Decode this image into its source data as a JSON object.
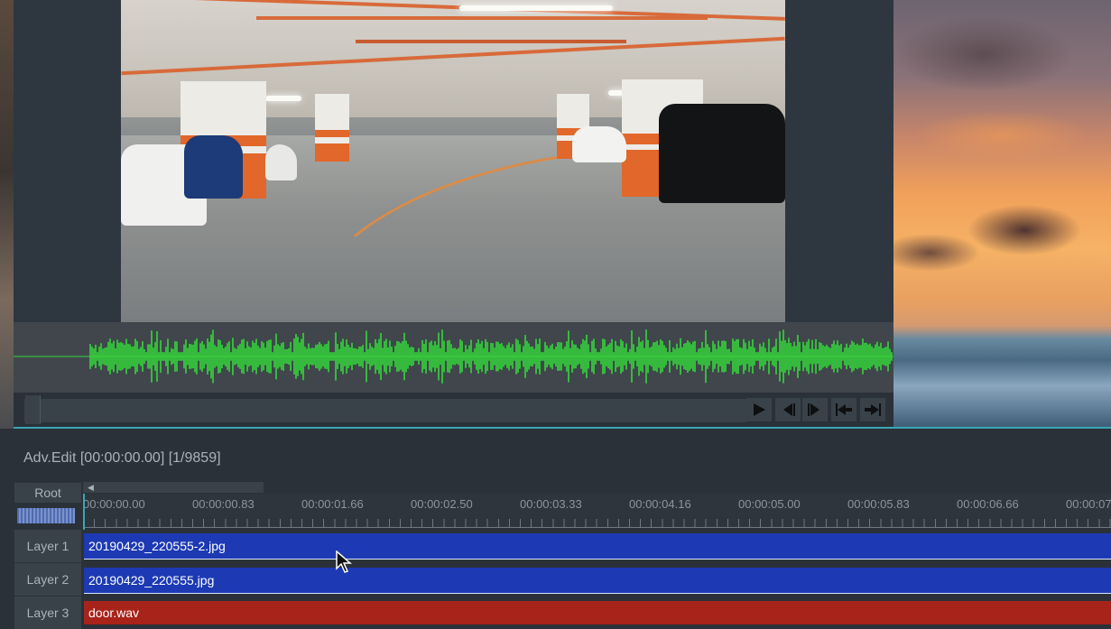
{
  "adv_edit": {
    "title": "Adv.Edit [00:00:00.00] [1/9859]",
    "root_label": "Root"
  },
  "timeline": {
    "tick_labels": [
      "00:00:00.00",
      "00:00:00.83",
      "00:00:01.66",
      "00:00:02.50",
      "00:00:03.33",
      "00:00:04.16",
      "00:00:05.00",
      "00:00:05.83",
      "00:00:06.66",
      "00:00:07"
    ],
    "layers": [
      {
        "label": "Layer  1",
        "clip": "20190429_220555-2.jpg",
        "clip_type": "image"
      },
      {
        "label": "Layer  2",
        "clip": "20190429_220555.jpg",
        "clip_type": "image"
      },
      {
        "label": "Layer  3",
        "clip": "door.wav",
        "clip_type": "audio"
      }
    ]
  },
  "transport": {
    "buttons": [
      "play-icon",
      "step-back-icon",
      "step-forward-icon",
      "go-to-start-icon",
      "go-to-end-icon"
    ]
  },
  "colors": {
    "accent": "#3aa6b4",
    "waveform": "#34d83a",
    "image_clip": "#1d3ab4",
    "audio_clip": "#a8231a",
    "panel_bg": "#2a3138"
  }
}
